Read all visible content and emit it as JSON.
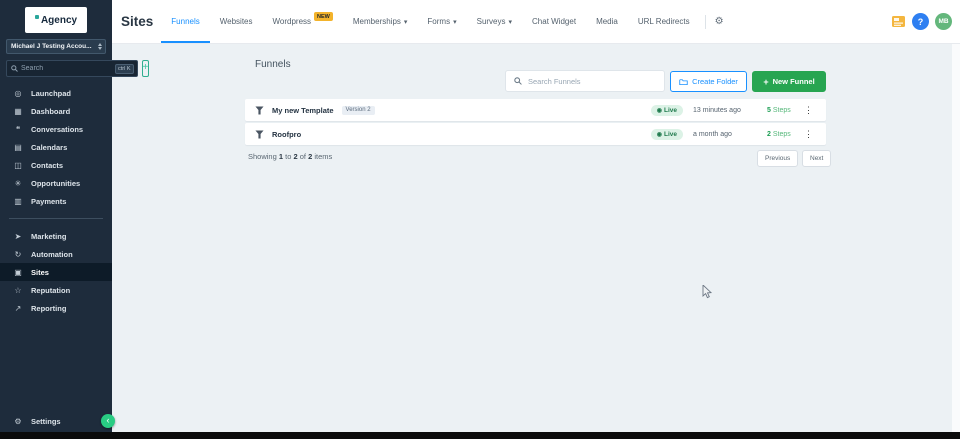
{
  "colors": {
    "accent_blue": "#1890ff",
    "accent_green": "#27a551",
    "badge_yellow": "#f3b32b",
    "live_bg": "#dcf2e6",
    "live_text": "#1f7a4d",
    "sidebar_bg": "#1e2c3c"
  },
  "sidebar": {
    "logo_text": "Agency",
    "account_name": "Michael J Testing Accou...",
    "search_placeholder": "Search",
    "search_shortcut": "ctrl K",
    "add_label": "+",
    "items": [
      {
        "label": "Launchpad",
        "glyph": "◎"
      },
      {
        "label": "Dashboard",
        "glyph": "▦"
      },
      {
        "label": "Conversations",
        "glyph": "❝"
      },
      {
        "label": "Calendars",
        "glyph": "▤"
      },
      {
        "label": "Contacts",
        "glyph": "◫"
      },
      {
        "label": "Opportunities",
        "glyph": "✳"
      },
      {
        "label": "Payments",
        "glyph": "▥"
      },
      {
        "label": "Marketing",
        "glyph": "➤"
      },
      {
        "label": "Automation",
        "glyph": "↻"
      },
      {
        "label": "Sites",
        "glyph": "▣"
      },
      {
        "label": "Reputation",
        "glyph": "☆"
      },
      {
        "label": "Reporting",
        "glyph": "↗"
      }
    ],
    "settings": {
      "label": "Settings",
      "glyph": "⚙"
    },
    "collapse_glyph": "‹"
  },
  "topbar": {
    "title": "Sites",
    "tabs": [
      {
        "label": "Funnels"
      },
      {
        "label": "Websites"
      },
      {
        "label": "Wordpress",
        "badge": "NEW"
      },
      {
        "label": "Memberships",
        "caret": "▾"
      },
      {
        "label": "Forms",
        "caret": "▾"
      },
      {
        "label": "Surveys",
        "caret": "▾"
      },
      {
        "label": "Chat Widget"
      },
      {
        "label": "Media"
      },
      {
        "label": "URL Redirects"
      }
    ],
    "gear_glyph": "⚙",
    "help_glyph": "?",
    "avatar_initials": "MB"
  },
  "content": {
    "heading": "Funnels",
    "search_placeholder": "Search Funnels",
    "create_folder": "Create Folder",
    "new_funnel": "New Funnel",
    "plus_glyph": "+",
    "rows": [
      {
        "name": "My new Template",
        "version": "Version 2",
        "status": "Live",
        "status_glyph": "◉",
        "updated": "13 minutes ago",
        "steps_count": "5",
        "steps_label": "Steps",
        "menu_glyph": "⋮"
      },
      {
        "name": "Roofpro",
        "status": "Live",
        "status_glyph": "◉",
        "updated": "a month ago",
        "steps_count": "2",
        "steps_label": "Steps",
        "menu_glyph": "⋮"
      }
    ],
    "pagination": {
      "showing": "Showing",
      "from": "1",
      "to_word": "to",
      "to": "2",
      "of_word": "of",
      "total": "2",
      "items_word": "items",
      "previous": "Previous",
      "next": "Next"
    }
  }
}
